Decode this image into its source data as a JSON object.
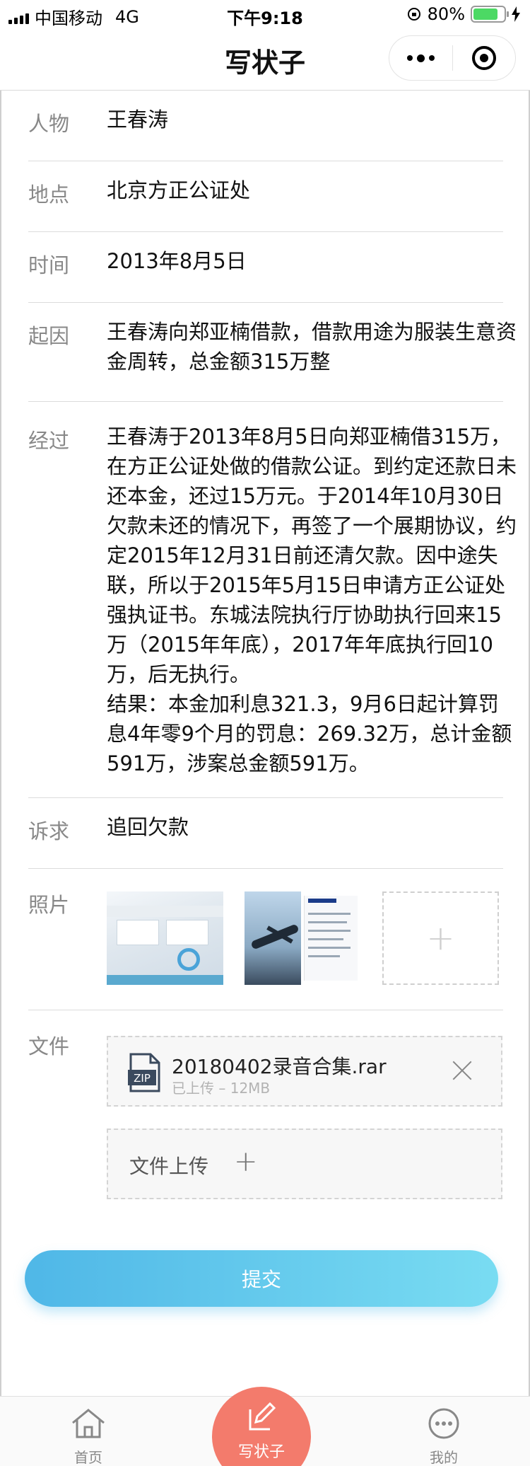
{
  "status_bar": {
    "carrier": "中国移动",
    "network": "4G",
    "time": "下午9:18",
    "battery": "80%",
    "battery_level": 0.8,
    "colors": {
      "battery_fill": "#4cd964"
    }
  },
  "nav": {
    "title": "写状子"
  },
  "form": {
    "person": {
      "label": "人物",
      "value": "王春涛"
    },
    "place": {
      "label": "地点",
      "value": "北京方正公证处"
    },
    "time": {
      "label": "时间",
      "value": "2013年8月5日"
    },
    "cause": {
      "label": "起因",
      "value": "王春涛向郑亚楠借款，借款用途为服装生意资金周转，总金额315万整"
    },
    "process": {
      "label": "经过",
      "value": "王春涛于2013年8月5日向郑亚楠借315万，在方正公证处做的借款公证。到约定还款日未还本金，还过15万元。于2014年10月30日欠款未还的情况下，再签了一个展期协议，约定2015年12月31日前还清欠款。因中途失联，所以于2015年5月15日申请方正公证处强执证书。东城法院执行厅协助执行回来15万（2015年年底），2017年年底执行回10万，后无执行。",
      "result": "结果：本金加利息321.3，9月6日起计算罚息4年零9个月的罚息：269.32万，总计金额591万，涉案总金额591万。"
    },
    "claim": {
      "label": "诉求",
      "value": "追回欠款"
    },
    "photos": {
      "label": "照片"
    },
    "files": {
      "label": "文件",
      "items": [
        {
          "name": "20180402录音合集.rar",
          "meta": "已上传 – 12MB",
          "icon_text": "ZIP"
        }
      ],
      "upload_label": "文件上传"
    }
  },
  "submit_label": "提交",
  "tabs": {
    "home": "首页",
    "write": "写状子",
    "mine": "我的"
  },
  "colors": {
    "submit_gradient_start": "#4fb7e7",
    "submit_gradient_end": "#79dcf2",
    "center_tab": "#f37b6c"
  }
}
